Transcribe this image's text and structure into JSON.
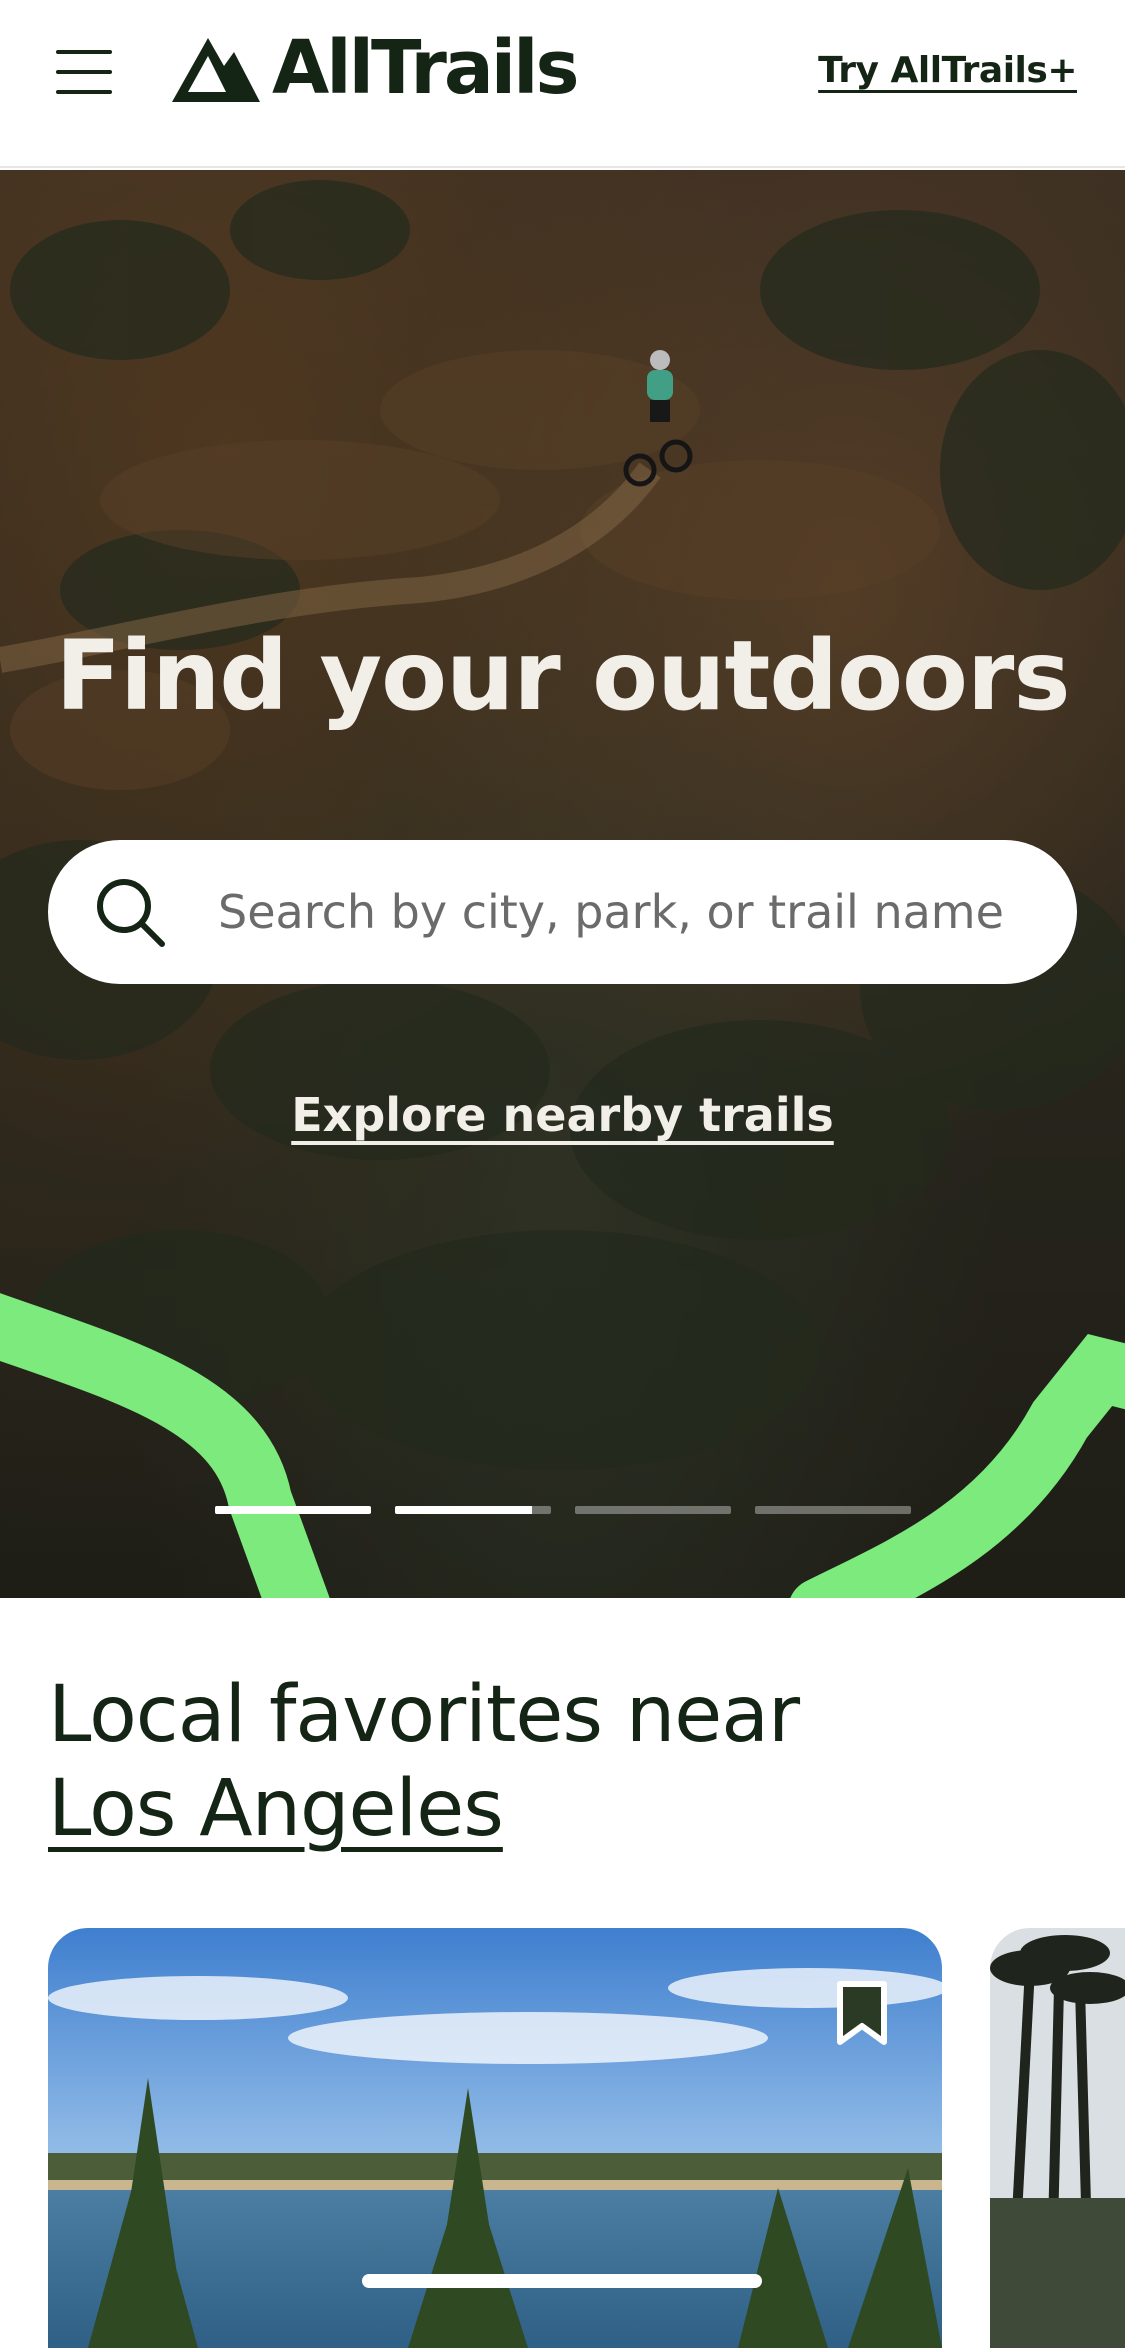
{
  "header": {
    "brand_name": "AllTrails",
    "try_plus_label": "Try AllTrails+",
    "icons": {
      "menu": "hamburger-menu-icon",
      "logo": "alltrails-mountain-logo"
    }
  },
  "hero": {
    "title": "Find your outdoors",
    "search": {
      "placeholder": "Search by city, park, or trail name",
      "icon": "search-icon"
    },
    "explore_link": "Explore nearby trails",
    "carousel": {
      "slides": 4,
      "progress": [
        1.0,
        0.88,
        0.0,
        0.0
      ]
    }
  },
  "section": {
    "title_prefix": "Local favorites near",
    "location": "Los Angeles"
  },
  "cards": [
    {
      "bookmark_icon": "bookmark-icon"
    },
    {}
  ],
  "colors": {
    "brand_dark": "#142415",
    "accent_green": "#7cea7c",
    "hero_text": "#f2efe9"
  }
}
